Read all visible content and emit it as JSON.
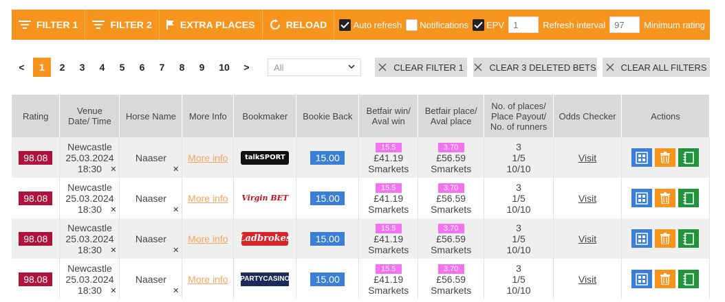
{
  "toolbar": {
    "filter1": "FILTER 1",
    "filter2": "FILTER 2",
    "extra_places": "EXTRA PLACES",
    "reload": "RELOAD",
    "auto_refresh": "Auto refresh",
    "notifications": "Notifications",
    "epv": "EPV",
    "epv_value": "1",
    "refresh_interval": "Refresh interval",
    "refresh_value": "97",
    "minimum_rating": "Minimum rating",
    "auto_refresh_checked": true,
    "notifications_checked": false,
    "epv_checked": true
  },
  "pager": {
    "prev": "<",
    "next": ">",
    "pages": [
      "1",
      "2",
      "3",
      "4",
      "5",
      "6",
      "7",
      "8",
      "9",
      "10"
    ],
    "current": "1"
  },
  "filter_select": {
    "value": "All"
  },
  "buttons": {
    "clear_filter1": "CLEAR FILTER 1",
    "clear_deleted": "CLEAR 3 DELETED BETS",
    "clear_all": "CLEAR ALL FILTERS"
  },
  "table": {
    "headers": {
      "rating": "Rating",
      "venue1": "Venue",
      "venue2": "Date/ Time",
      "horse": "Horse Name",
      "more_info": "More Info",
      "bookmaker": "Bookmaker",
      "bookie_back": "Bookie Back",
      "bf_win1": "Betfair win/",
      "bf_win2": "Aval win",
      "bf_place1": "Betfair place/",
      "bf_place2": "Aval place",
      "places1": "No. of places/",
      "places2": "Place Payout/",
      "places3": "No. of runners",
      "odds_checker": "Odds Checker",
      "actions": "Actions"
    },
    "rows": [
      {
        "rating": "98.08",
        "venue": "Newcastle",
        "date": "25.03.2024",
        "time": "18:30",
        "horse": "Naaser",
        "more": "More info",
        "bookmaker": "talkSPORT",
        "back": "15.00",
        "win_tag": "15.5",
        "win_aval": "£41.19",
        "win_exch": "Smarkets",
        "place_tag": "3.70",
        "place_aval": "£56.59",
        "place_exch": "Smarkets",
        "places": "3",
        "payout": "1/5",
        "runners": "10/10",
        "visit": "Visit"
      },
      {
        "rating": "98.08",
        "venue": "Newcastle",
        "date": "25.03.2024",
        "time": "18:30",
        "horse": "Naaser",
        "more": "More info",
        "bookmaker": "Virgin BET",
        "back": "15.00",
        "win_tag": "15.5",
        "win_aval": "£41.19",
        "win_exch": "Smarkets",
        "place_tag": "3.70",
        "place_aval": "£56.59",
        "place_exch": "Smarkets",
        "places": "3",
        "payout": "1/5",
        "runners": "10/10",
        "visit": "Visit"
      },
      {
        "rating": "98.08",
        "venue": "Newcastle",
        "date": "25.03.2024",
        "time": "18:30",
        "horse": "Naaser",
        "more": "More info",
        "bookmaker": "Ladbrokes",
        "back": "15.00",
        "win_tag": "15.5",
        "win_aval": "£41.19",
        "win_exch": "Smarkets",
        "place_tag": "3.70",
        "place_aval": "£56.59",
        "place_exch": "Smarkets",
        "places": "3",
        "payout": "1/5",
        "runners": "10/10",
        "visit": "Visit"
      },
      {
        "rating": "98.08",
        "venue": "Newcastle",
        "date": "25.03.2024",
        "time": "18:30",
        "horse": "Naaser",
        "more": "More info",
        "bookmaker": "PARTYCASINO",
        "back": "15.00",
        "win_tag": "15.5",
        "win_aval": "£41.19",
        "win_exch": "Smarkets",
        "place_tag": "3.70",
        "place_aval": "£56.59",
        "place_exch": "Smarkets",
        "places": "3",
        "payout": "1/5",
        "runners": "10/10",
        "visit": "Visit"
      }
    ]
  },
  "colors": {
    "accent": "#f7941d",
    "rating_bg": "#b0123e",
    "back_bg": "#3a7fd5",
    "exchange_tag": "#f372f0",
    "action_green": "#23923d"
  }
}
